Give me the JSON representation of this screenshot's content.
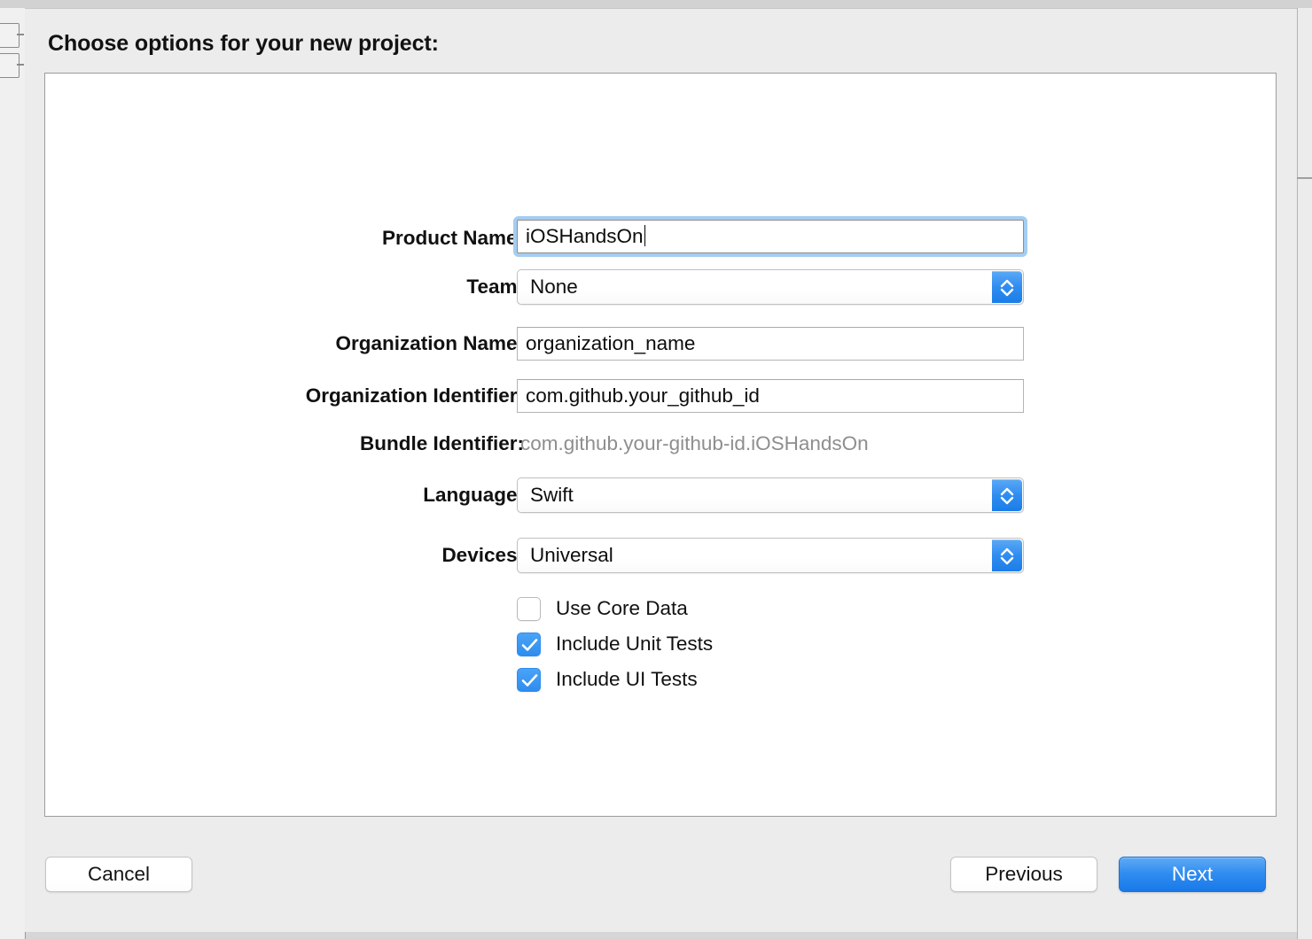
{
  "window": {
    "sheet_title": "Choose options for your new project:"
  },
  "form": {
    "fields": [
      {
        "label": "Product Name:",
        "value": "iOSHandsOn",
        "kind": "text-focused"
      },
      {
        "label": "Team:",
        "value": "None",
        "kind": "popup"
      },
      {
        "label": "Organization Name:",
        "value": "organization_name",
        "kind": "text"
      },
      {
        "label": "Organization Identifier:",
        "value": "com.github.your_github_id",
        "kind": "text"
      },
      {
        "label": "Bundle Identifier:",
        "value": "com.github.your-github-id.iOSHandsOn",
        "kind": "static"
      },
      {
        "label": "Language:",
        "value": "Swift",
        "kind": "popup"
      },
      {
        "label": "Devices:",
        "value": "Universal",
        "kind": "popup"
      }
    ],
    "checkboxes": [
      {
        "label": "Use Core Data",
        "checked": false
      },
      {
        "label": "Include Unit Tests",
        "checked": true
      },
      {
        "label": "Include UI Tests",
        "checked": true
      }
    ]
  },
  "buttons": {
    "cancel": "Cancel",
    "previous": "Previous",
    "next": "Next"
  },
  "colors": {
    "accent_blue": "#2f8df0",
    "focus_ring": "#a5cdf2",
    "sheet_background": "#ececec",
    "panel_background": "#ffffff",
    "muted_text": "#8e8e8e"
  }
}
